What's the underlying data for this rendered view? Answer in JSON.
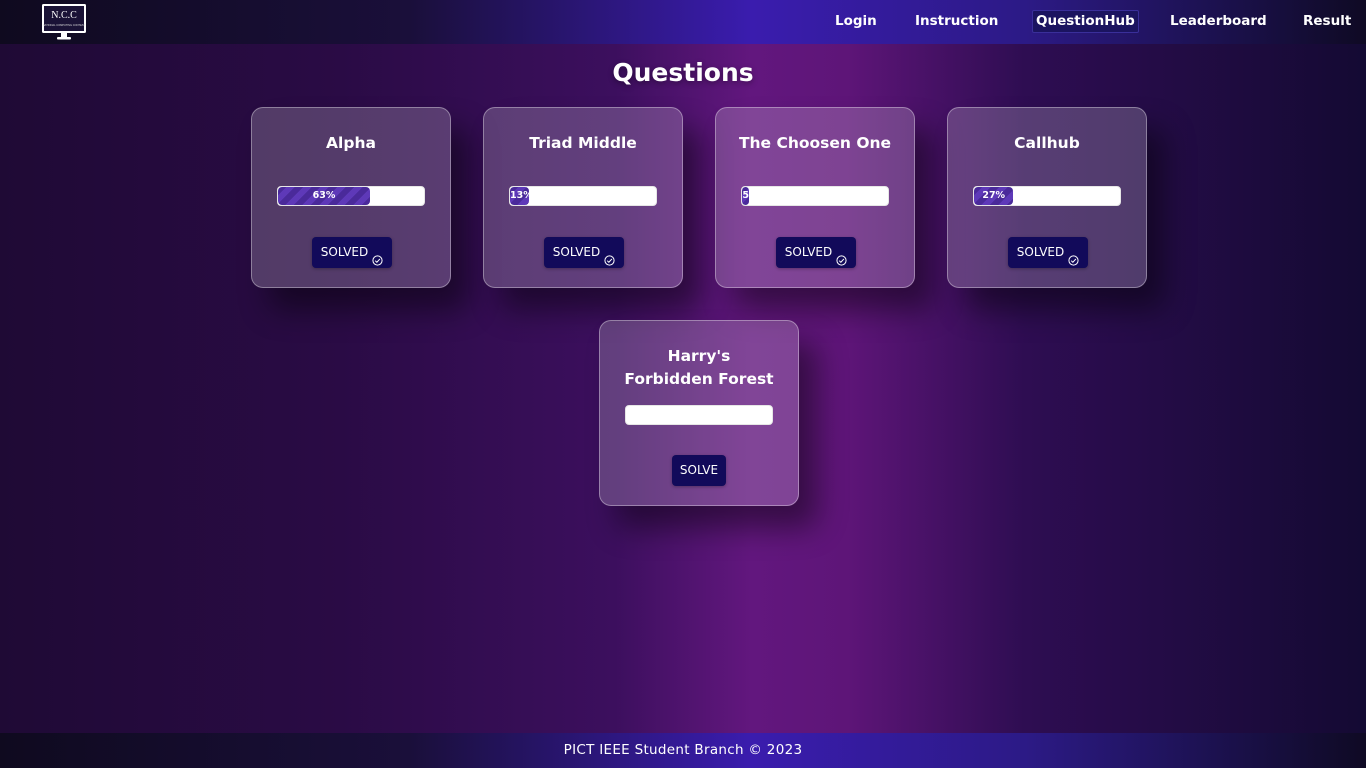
{
  "nav": {
    "logo_text": "N.C.C",
    "logo_subtext": "NATIONAL COMPUTING CONTEST",
    "links": [
      {
        "label": "Login",
        "active": false
      },
      {
        "label": "Instruction",
        "active": false
      },
      {
        "label": "QuestionHub",
        "active": true
      },
      {
        "label": "Leaderboard",
        "active": false
      },
      {
        "label": "Result",
        "active": false
      }
    ]
  },
  "page": {
    "title": "Questions"
  },
  "questions": [
    {
      "title": "Alpha",
      "progress": 63,
      "progress_label": "63%",
      "button_label": "SOLVED",
      "solved": true
    },
    {
      "title": "Triad Middle",
      "progress": 13,
      "progress_label": "13%",
      "button_label": "SOLVED",
      "solved": true
    },
    {
      "title": "The Choosen One",
      "progress": 5,
      "progress_label": "5",
      "button_label": "SOLVED",
      "solved": true
    },
    {
      "title": "Callhub",
      "progress": 27,
      "progress_label": "27%",
      "button_label": "SOLVED",
      "solved": true
    },
    {
      "title": "Harry's Forbidden Forest",
      "progress": 0,
      "progress_label": "",
      "button_label": "SOLVE",
      "solved": false
    }
  ],
  "footer": {
    "text": "PICT IEEE Student Branch © 2023"
  },
  "colors": {
    "button_bg": "#120a5a",
    "progress_fill": "#4a2a9a",
    "nav_active_bg": "#1b1460"
  },
  "icons": {
    "solved": "check-circle-icon"
  }
}
